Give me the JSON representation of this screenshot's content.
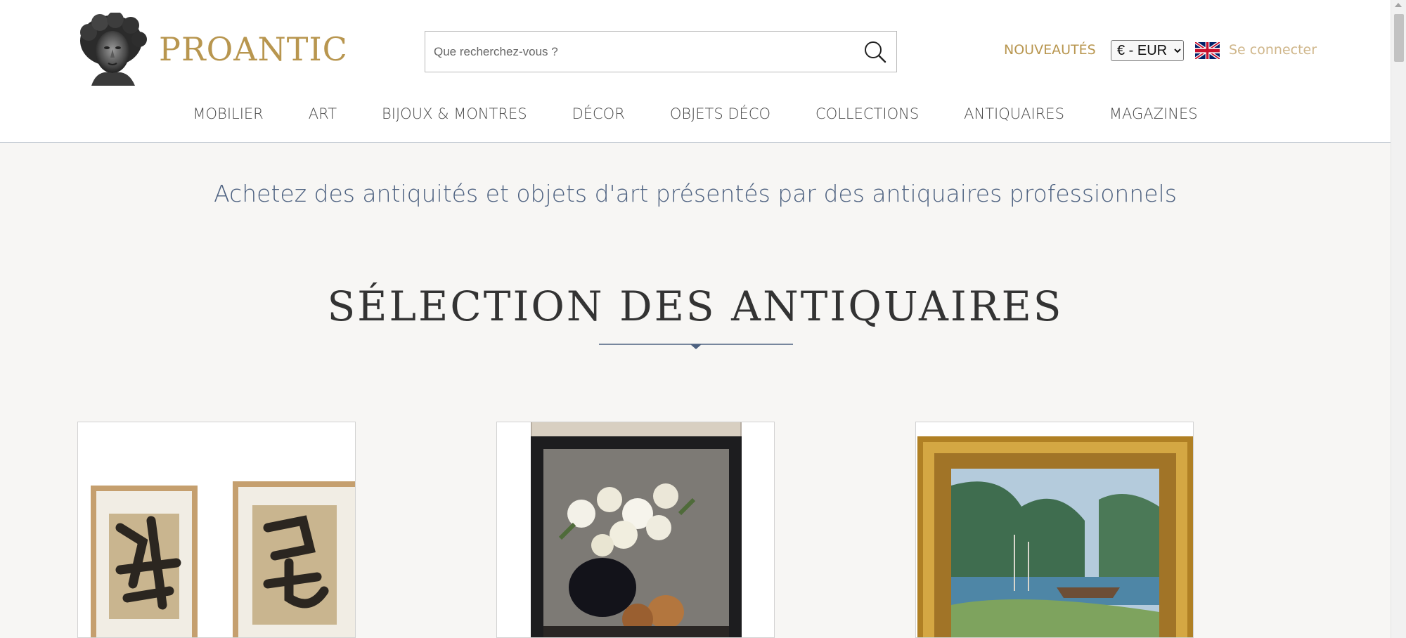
{
  "brand": {
    "name": "PROANTIC"
  },
  "search": {
    "placeholder": "Que recherchez-vous ?"
  },
  "header_links": {
    "new_label": "NOUVEAUTÉS",
    "currency_selected": "€ - EUR",
    "language_icon": "uk-flag-icon",
    "signin_label": "Se connecter"
  },
  "nav": {
    "items": [
      "MOBILIER",
      "ART",
      "BIJOUX & MONTRES",
      "DÉCOR",
      "OBJETS DÉCO",
      "COLLECTIONS",
      "ANTIQUAIRES",
      "MAGAZINES"
    ]
  },
  "main": {
    "tagline": "Achetez des antiquités et objets d'art présentés par des antiquaires professionnels",
    "section_title": "SÉLECTION DES ANTIQUAIRES"
  },
  "colors": {
    "gold": "#b8964f",
    "gold_light": "#cfb68a",
    "slate_blue": "#4d6180",
    "page_bg": "#f7f6f4"
  }
}
